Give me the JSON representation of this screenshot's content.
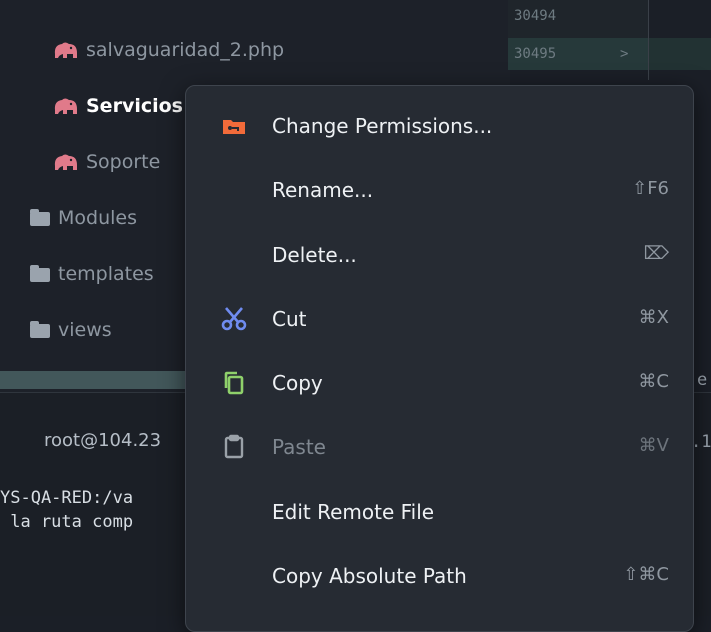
{
  "tree": {
    "items": [
      {
        "label": "salvaguaridad_2.php",
        "kind": "php"
      },
      {
        "label": "Servicios",
        "kind": "php"
      },
      {
        "label": "Soporte",
        "kind": "php"
      },
      {
        "label": "Modules",
        "kind": "folder"
      },
      {
        "label": "templates",
        "kind": "folder"
      },
      {
        "label": "views",
        "kind": "folder"
      }
    ]
  },
  "gutter": {
    "lines": [
      "30494",
      "30495"
    ],
    "arrow": ">"
  },
  "terminal": {
    "tab_label": "root@104.23",
    "lines": [
      "YS-QA-RED:/va",
      " la ruta comp"
    ],
    "right_fragments": [
      "e",
      ".1"
    ]
  },
  "context_menu": {
    "items": [
      {
        "label": "Change Permissions...",
        "shortcut": "",
        "icon": "key-folder-icon",
        "enabled": true
      },
      {
        "label": "Rename...",
        "shortcut": "⇧F6",
        "icon": "",
        "enabled": true
      },
      {
        "label": "Delete...",
        "shortcut": "⌦",
        "icon": "",
        "enabled": true
      },
      {
        "label": "Cut",
        "shortcut": "⌘X",
        "icon": "scissors-icon",
        "enabled": true
      },
      {
        "label": "Copy",
        "shortcut": "⌘C",
        "icon": "copy-icon",
        "enabled": true
      },
      {
        "label": "Paste",
        "shortcut": "⌘V",
        "icon": "clipboard-icon",
        "enabled": false
      },
      {
        "label": "Edit Remote File",
        "shortcut": "",
        "icon": "",
        "enabled": true
      },
      {
        "label": "Copy Absolute Path",
        "shortcut": "⇧⌘C",
        "icon": "",
        "enabled": true
      }
    ]
  },
  "colors": {
    "php_icon": "#e07a8a",
    "folder_icon": "#9aa3ad",
    "scissors": "#6f8cf0",
    "copy": "#8fd16b",
    "key_folder": "#f26b3a",
    "scrollbar": "#42575a"
  }
}
